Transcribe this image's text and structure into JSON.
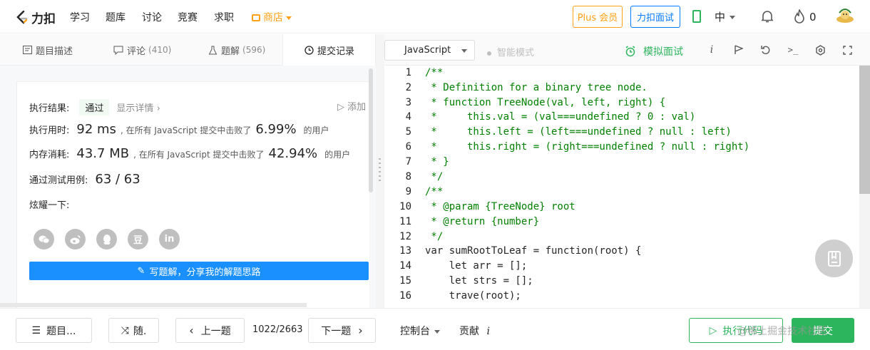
{
  "nav": {
    "logo_text": "力扣",
    "links": [
      "学习",
      "题库",
      "讨论",
      "竞赛",
      "求职"
    ],
    "store": "商店",
    "plus_button": "Plus 会员",
    "interview_button": "力扣面试",
    "language": "中",
    "flame_count": "0",
    "colors": {
      "brand_orange": "#ffa116",
      "blue": "#007aff",
      "green": "#2db55d"
    }
  },
  "left_tabs": [
    {
      "label": "题目描述",
      "count": ""
    },
    {
      "label": "评论",
      "count": "(410)"
    },
    {
      "label": "题解",
      "count": "(596)"
    },
    {
      "label": "提交记录",
      "count": ""
    }
  ],
  "result": {
    "label": "执行结果:",
    "status": "通过",
    "details_link": "显示详情",
    "add_note": "添加",
    "runtime_label": "执行用时:",
    "runtime_value": "92 ms",
    "runtime_text": ", 在所有 JavaScript 提交中击败了",
    "runtime_percent": "6.99%",
    "runtime_suffix": "的用户",
    "memory_label": "内存消耗:",
    "memory_value": "43.7 MB",
    "memory_text": ", 在所有 JavaScript 提交中击败了",
    "memory_percent": "42.94%",
    "memory_suffix": "的用户",
    "tests_label": "通过测试用例:",
    "tests_value": "63 / 63",
    "share_label": "炫耀一下:",
    "share_icons": [
      "wechat-icon",
      "weibo-icon",
      "qq-icon",
      "douban-icon",
      "linkedin-icon"
    ],
    "douban_glyph": "豆",
    "linkedin_glyph": "in",
    "write_solution": "写题解，分享我的解题思路"
  },
  "editor": {
    "language": "JavaScript",
    "smart_mode": "智能模式",
    "mock_interview": "模拟面试",
    "line_numbers": [
      "1",
      "2",
      "3",
      "4",
      "5",
      "6",
      "7",
      "8",
      "9",
      "10",
      "11",
      "12",
      "13",
      "14",
      "15",
      "16"
    ],
    "code": [
      "/**",
      " * Definition for a binary tree node.",
      " * function TreeNode(val, left, right) {",
      " *     this.val = (val===undefined ? 0 : val)",
      " *     this.left = (left===undefined ? null : left)",
      " *     this.right = (right===undefined ? null : right)",
      " * }",
      " */",
      "/**",
      " * @param {TreeNode} root",
      " * @return {number}",
      " */",
      "var sumRootToLeaf = function(root) {",
      "    let arr = [];",
      "    let strs = [];",
      "    trave(root);"
    ]
  },
  "bottom": {
    "problem_list": "题目...",
    "random": "随.",
    "prev": "上一题",
    "page": "1022/2663",
    "next": "下一题",
    "console": "控制台",
    "contribute": "贡献",
    "contribute_i": "i",
    "run": "执行代码",
    "submit": "提交",
    "watermark": "@稀土掘金技术社区"
  }
}
